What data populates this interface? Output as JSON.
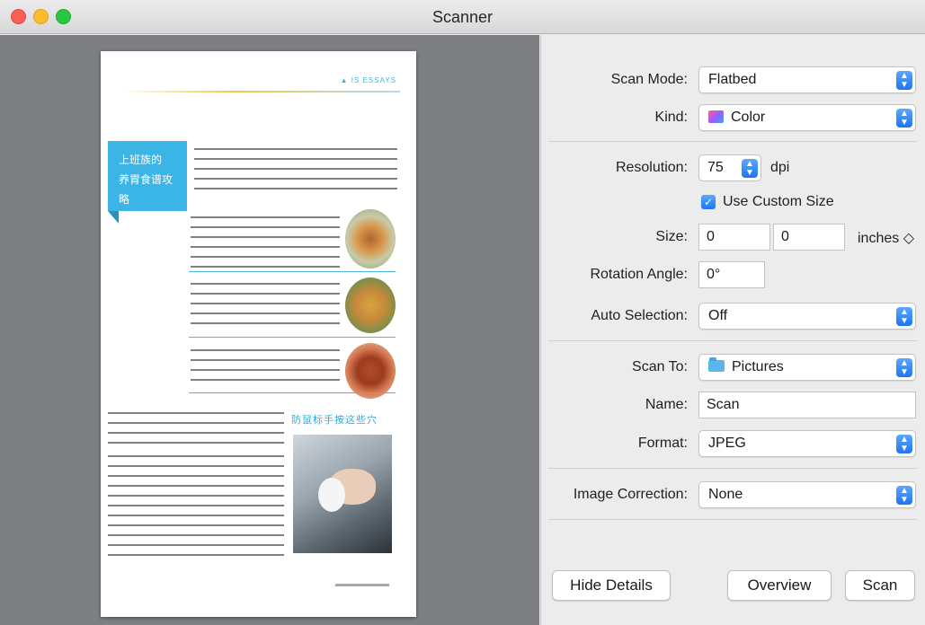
{
  "window": {
    "title": "Scanner"
  },
  "preview": {
    "header_text": "▲ IS ESSAYS",
    "tab_title_line1": "上班族的",
    "tab_title_line2": "养胃食谱攻略",
    "section_heading": "防鼠标手按这些穴"
  },
  "settings": {
    "scan_mode": {
      "label": "Scan Mode:",
      "value": "Flatbed"
    },
    "kind": {
      "label": "Kind:",
      "value": "Color"
    },
    "resolution": {
      "label": "Resolution:",
      "value": "75",
      "unit": "dpi"
    },
    "use_custom_size": {
      "label": "Use Custom Size",
      "checked": true
    },
    "size": {
      "label": "Size:",
      "width": "0",
      "height": "0",
      "unit": "inches ◇"
    },
    "rotation": {
      "label": "Rotation Angle:",
      "value": "0°"
    },
    "auto_selection": {
      "label": "Auto Selection:",
      "value": "Off"
    },
    "scan_to": {
      "label": "Scan To:",
      "value": "Pictures"
    },
    "name": {
      "label": "Name:",
      "value": "Scan"
    },
    "format": {
      "label": "Format:",
      "value": "JPEG"
    },
    "image_correction": {
      "label": "Image Correction:",
      "value": "None"
    }
  },
  "buttons": {
    "hide_details": "Hide Details",
    "overview": "Overview",
    "scan": "Scan"
  },
  "icons": {
    "popup_arrow": "◇",
    "check": "✓"
  },
  "colors": {
    "accent": "#1f74f0",
    "preview_bg": "#7d7f82"
  }
}
